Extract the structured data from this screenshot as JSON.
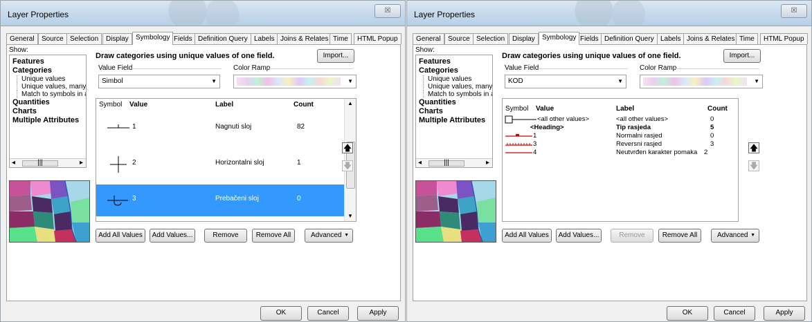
{
  "windows": [
    {
      "title": "Layer Properties",
      "close": "☒",
      "tabs": [
        "General",
        "Source",
        "Selection",
        "Display",
        "Symbology",
        "Fields",
        "Definition Query",
        "Labels",
        "Joins & Relates",
        "Time",
        "HTML Popup"
      ],
      "show_label": "Show:",
      "tree": {
        "features": "Features",
        "categories": "Categories",
        "unique": "Unique values",
        "unique_many": "Unique values, many",
        "match": "Match to symbols in a",
        "quantities": "Quantities",
        "charts": "Charts",
        "multiple": "Multiple Attributes"
      },
      "heading": "Draw categories using unique values of one field.",
      "import": "Import...",
      "value_field_label": "Value Field",
      "value_field": "Simbol",
      "color_ramp_label": "Color Ramp",
      "columns": {
        "symbol": "Symbol",
        "value": "Value",
        "label": "Label",
        "count": "Count"
      },
      "rows": [
        {
          "value": "1",
          "label": "Nagnuti sloj",
          "count": "82"
        },
        {
          "value": "2",
          "label": "Horizontalni sloj",
          "count": "1"
        },
        {
          "value": "3",
          "label": "Prebačeni sloj",
          "count": "0"
        }
      ],
      "buttons": {
        "add_all": "Add All Values",
        "add": "Add Values...",
        "remove": "Remove",
        "remove_all": "Remove All",
        "advanced": "Advanced"
      },
      "footer": {
        "ok": "OK",
        "cancel": "Cancel",
        "apply": "Apply"
      }
    },
    {
      "title": "Layer Properties",
      "close": "☒",
      "tabs": [
        "General",
        "Source",
        "Selection",
        "Display",
        "Symbology",
        "Fields",
        "Definition Query",
        "Labels",
        "Joins & Relates",
        "Time",
        "HTML Popup"
      ],
      "show_label": "Show:",
      "tree": {
        "features": "Features",
        "categories": "Categories",
        "unique": "Unique values",
        "unique_many": "Unique values, many",
        "match": "Match to symbols in a",
        "quantities": "Quantities",
        "charts": "Charts",
        "multiple": "Multiple Attributes"
      },
      "heading": "Draw categories using unique values of one field.",
      "import": "Import...",
      "value_field_label": "Value Field",
      "value_field": "KOD",
      "color_ramp_label": "Color Ramp",
      "columns": {
        "symbol": "Symbol",
        "value": "Value",
        "label": "Label",
        "count": "Count"
      },
      "rows": [
        {
          "value": "<all other values>",
          "label": "<all other values>",
          "count": "0"
        },
        {
          "value": "<Heading>",
          "label": "Tip rasjeda",
          "count": "5"
        },
        {
          "value": "1",
          "label": "Normalni rasjed",
          "count": "0"
        },
        {
          "value": "3",
          "label": "Reversni rasjed",
          "count": "3"
        },
        {
          "value": "4",
          "label": "Neutvrđen karakter pomaka",
          "count": "2"
        }
      ],
      "buttons": {
        "add_all": "Add All Values",
        "add": "Add Values...",
        "remove": "Remove",
        "remove_all": "Remove All",
        "advanced": "Advanced"
      },
      "footer": {
        "ok": "OK",
        "cancel": "Cancel",
        "apply": "Apply"
      }
    }
  ],
  "colors": {
    "selection": "#3399ff",
    "fault_red": "#cc0000"
  }
}
